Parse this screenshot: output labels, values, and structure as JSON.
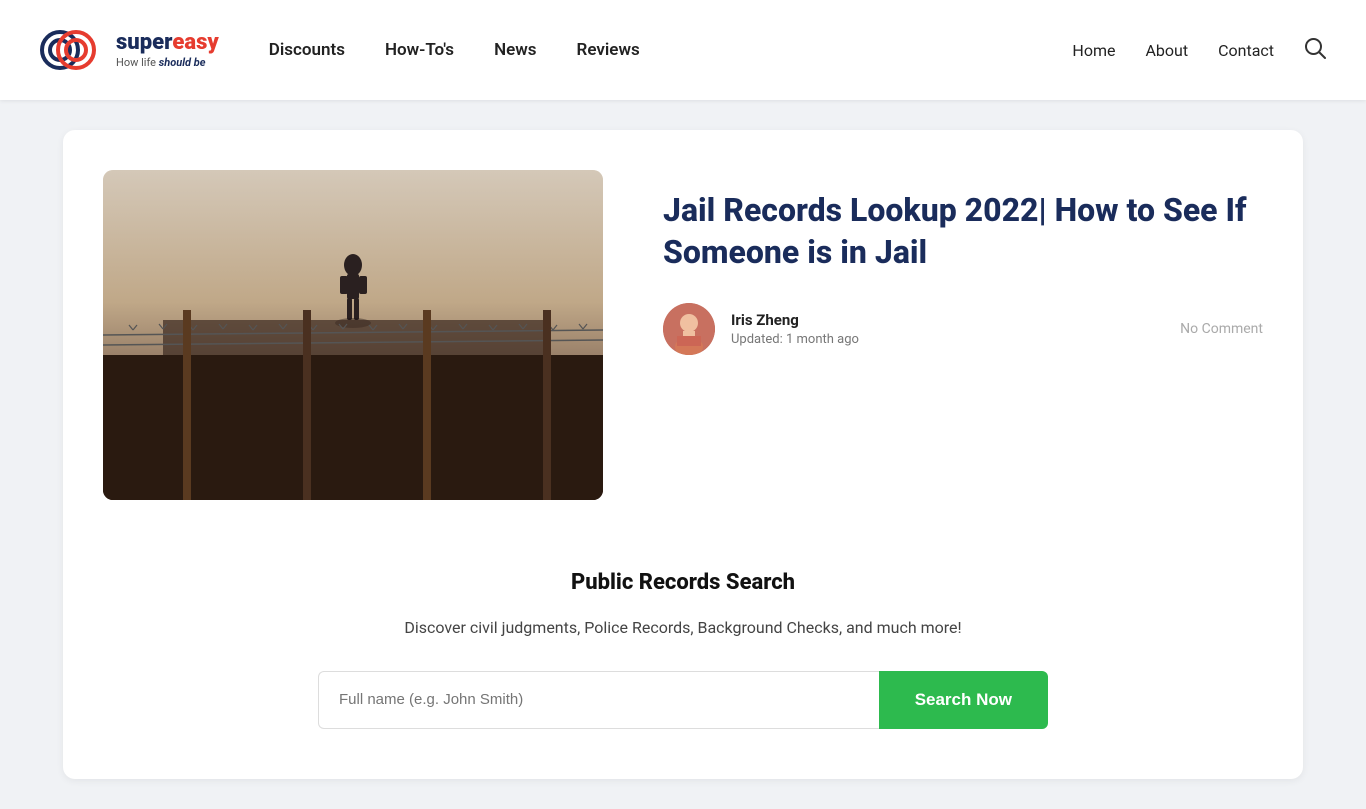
{
  "header": {
    "logo": {
      "super": "super",
      "easy": "easy",
      "tagline_normal": "How life ",
      "tagline_emphasis": "should be"
    },
    "nav": {
      "items": [
        {
          "label": "Discounts",
          "id": "discounts"
        },
        {
          "label": "How-To's",
          "id": "howtos"
        },
        {
          "label": "News",
          "id": "news"
        },
        {
          "label": "Reviews",
          "id": "reviews"
        }
      ]
    },
    "right_nav": {
      "items": [
        {
          "label": "Home",
          "id": "home"
        },
        {
          "label": "About",
          "id": "about"
        },
        {
          "label": "Contact",
          "id": "contact"
        }
      ]
    }
  },
  "article": {
    "title": "Jail Records Lookup 2022| How to See If Someone is in Jail",
    "author_name": "Iris Zheng",
    "updated": "Updated: 1 month ago",
    "no_comment": "No Comment"
  },
  "search_section": {
    "title": "Public Records Search",
    "description": "Discover civil judgments, Police Records, Background Checks, and much more!",
    "input_placeholder": "Full name (e.g. John Smith)",
    "button_label": "Search Now"
  }
}
